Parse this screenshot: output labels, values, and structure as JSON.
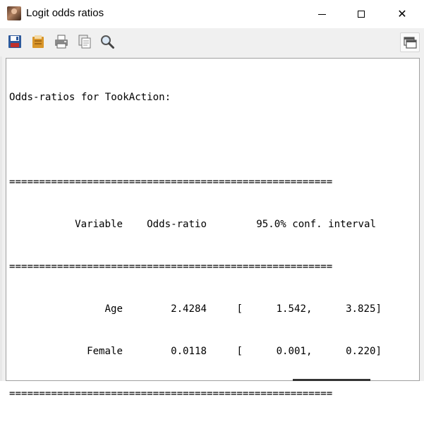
{
  "window": {
    "title": "Logit odds ratios",
    "icon": "app-portrait-icon"
  },
  "title_controls": {
    "minimize_icon": "minimize-icon",
    "maximize_icon": "maximize-icon",
    "close_glyph": "✕"
  },
  "toolbar": {
    "items": [
      "save-icon",
      "open-icon",
      "print-icon",
      "copy-icon",
      "find-icon",
      "window-icon"
    ]
  },
  "output": {
    "heading": "Odds-ratios for TookAction:",
    "rule": "======================================================",
    "columns": [
      "Variable",
      "Odds-ratio",
      "95.0% conf. interval"
    ],
    "rows": [
      {
        "variable": "Age",
        "odds_ratio": "2.4284",
        "ci_low": "1.542",
        "ci_high": "3.825"
      },
      {
        "variable": "Female",
        "odds_ratio": "0.0118",
        "ci_low": "0.001",
        "ci_high": "0.220"
      }
    ]
  },
  "colors": {
    "save_icon": "#c0302c",
    "open_icon": "#d9962a",
    "window_bg": "#f0f0f0"
  }
}
